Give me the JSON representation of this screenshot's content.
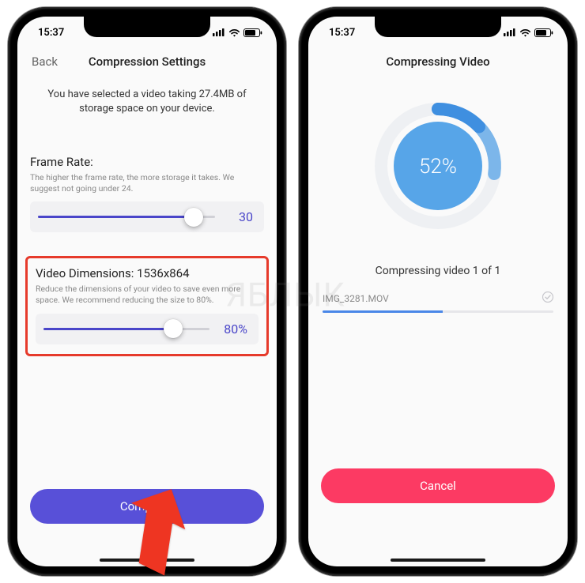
{
  "status": {
    "time": "15:37"
  },
  "left": {
    "back": "Back",
    "title": "Compression Settings",
    "info": "You have selected a video taking 27.4MB of storage space on your device.",
    "frame": {
      "title": "Frame Rate:",
      "desc": "The higher the frame rate, the more storage it takes. We suggest not going under 24.",
      "value": "30",
      "fill_pct": 88
    },
    "dim": {
      "title": "Video Dimensions: 1536x864",
      "desc": "Reduce the dimensions of your video to save even more space. We recommend reducing the size to 80%.",
      "value": "80%",
      "fill_pct": 78
    },
    "button": "Compress"
  },
  "right": {
    "title": "Compressing Video",
    "percent": "52%",
    "message": "Compressing video 1 of 1",
    "filename": "IMG_3281.MOV",
    "button": "Cancel"
  },
  "watermark": "ЯБЛЫК"
}
